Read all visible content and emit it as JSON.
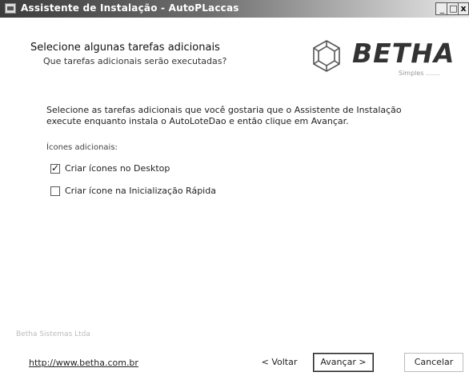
{
  "window": {
    "title": "Assistente de Instalação - AutoPLaccas",
    "controls": {
      "minimize": "_",
      "maximize": "□",
      "close": "x"
    }
  },
  "header": {
    "title": "Selecione algunas tarefas adicionais",
    "subtitle": "Que tarefas adicionais serão executadas?"
  },
  "logo": {
    "brand": "BETHA",
    "sub": "Simples ......."
  },
  "content": {
    "description": "Selecione as tarefas adicionais que você gostaria que o Assistente de Instalação execute enquanto instala o AutoLoteDao e então clique em Avançar.",
    "group_label": "Ícones adicionais:",
    "options": [
      {
        "label": "Criar ícones no Desktop",
        "checked": true
      },
      {
        "label": "Criar ícone na Inicialização Rápida",
        "checked": false
      }
    ]
  },
  "footer": {
    "brand_text": "Betha Sistemas Ltda",
    "link": "http://www.betha.com.br",
    "buttons": {
      "back": "< Voltar",
      "next": "Avançar >",
      "cancel": "Cancelar"
    }
  },
  "icons": [
    "app-icon",
    "betha-logo-icon",
    "checkbox-checked",
    "checkbox-unchecked"
  ]
}
